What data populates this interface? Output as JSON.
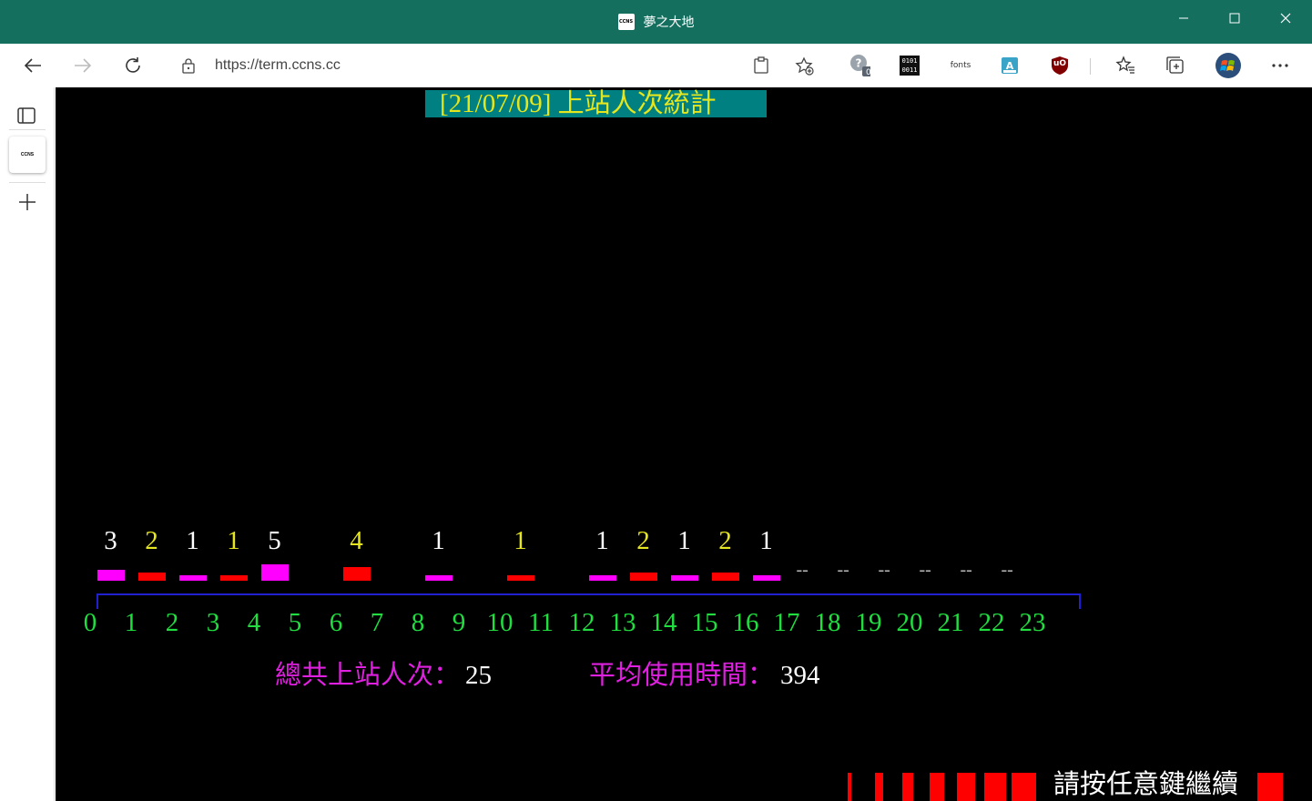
{
  "window": {
    "title": "夢之大地",
    "favicon_text": "CCNS"
  },
  "nav": {
    "url": "https://term.ccns.cc"
  },
  "extensions": {
    "badge_count": "0",
    "binary_icon_text": "0101\n0011",
    "fonts_label": "fonts",
    "ublock_label": "uO"
  },
  "terminal": {
    "title": "[21/07/09] 上站人次統計",
    "hours": [
      "0",
      "1",
      "2",
      "3",
      "4",
      "5",
      "6",
      "7",
      "8",
      "9",
      "10",
      "11",
      "12",
      "13",
      "14",
      "15",
      "16",
      "17",
      "18",
      "19",
      "20",
      "21",
      "22",
      "23"
    ],
    "no_data_marker": "--",
    "summary": {
      "total_label": "總共上站人次：",
      "total_value": "25",
      "avg_label": "平均使用時間：",
      "avg_value": "394"
    },
    "prompt": "請按任意鍵繼續"
  },
  "colors": {
    "titlebar": "#156f5f",
    "title_bg": "#008080",
    "title_fg": "#e6e61e",
    "bar_magenta": "#ff00ff",
    "bar_red": "#ff0000",
    "axis": "#2020d0",
    "hour_label": "#20dd40",
    "summary_label": "#e020e0"
  },
  "chart_data": {
    "type": "bar",
    "categories": [
      "1",
      "2",
      "3",
      "4",
      "5",
      "7",
      "9",
      "11",
      "13",
      "14",
      "15",
      "16",
      "17"
    ],
    "values": [
      3,
      2,
      1,
      1,
      5,
      4,
      1,
      1,
      1,
      2,
      1,
      2,
      1
    ],
    "title": "[21/07/09] 上站人次統計",
    "xlabel": "",
    "ylabel": "",
    "no_data_hours": [
      "18",
      "19",
      "20",
      "21",
      "22",
      "23"
    ]
  }
}
